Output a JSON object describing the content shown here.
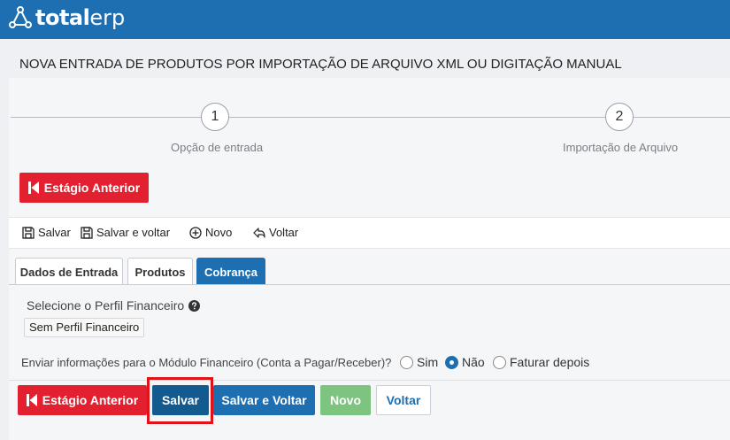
{
  "app": {
    "logo_bold": "total",
    "logo_light": "erp",
    "brand_color": "#1d6fb1",
    "logo_icon": "network-logo-icon"
  },
  "page": {
    "title": "NOVA ENTRADA DE PRODUTOS POR IMPORTAÇÃO DE ARQUIVO XML OU DIGITAÇÃO MANUAL"
  },
  "steps": [
    {
      "number": "1",
      "label": "Opção de entrada"
    },
    {
      "number": "2",
      "label": "Importação de Arquivo"
    }
  ],
  "buttons": {
    "previous_stage_top": "Estágio Anterior",
    "previous_stage_bottom": "Estágio Anterior",
    "save": "Salvar",
    "save_and_back": "Salvar e Voltar",
    "new": "Novo",
    "back": "Voltar"
  },
  "toolbar": {
    "save": "Salvar",
    "save_and_back": "Salvar e voltar",
    "new": "Novo",
    "back": "Voltar"
  },
  "tabs": [
    {
      "label": "Dados de Entrada",
      "active": false
    },
    {
      "label": "Produtos",
      "active": false
    },
    {
      "label": "Cobrança",
      "active": true
    }
  ],
  "form": {
    "perfil_label": "Selecione o Perfil Financeiro",
    "perfil_value": "Sem Perfil Financeiro",
    "enviar_label": "Enviar informações para o Módulo Financeiro (Conta a Pagar/Receber)?",
    "options": [
      {
        "label": "Sim",
        "checked": false
      },
      {
        "label": "Não",
        "checked": true
      },
      {
        "label": "Faturar depois",
        "checked": false
      }
    ]
  },
  "colors": {
    "red": "#e3202f",
    "blue": "#1d6fb1",
    "dark_blue": "#135a8f",
    "green": "#7cc47f",
    "highlight": "#e0121a"
  }
}
